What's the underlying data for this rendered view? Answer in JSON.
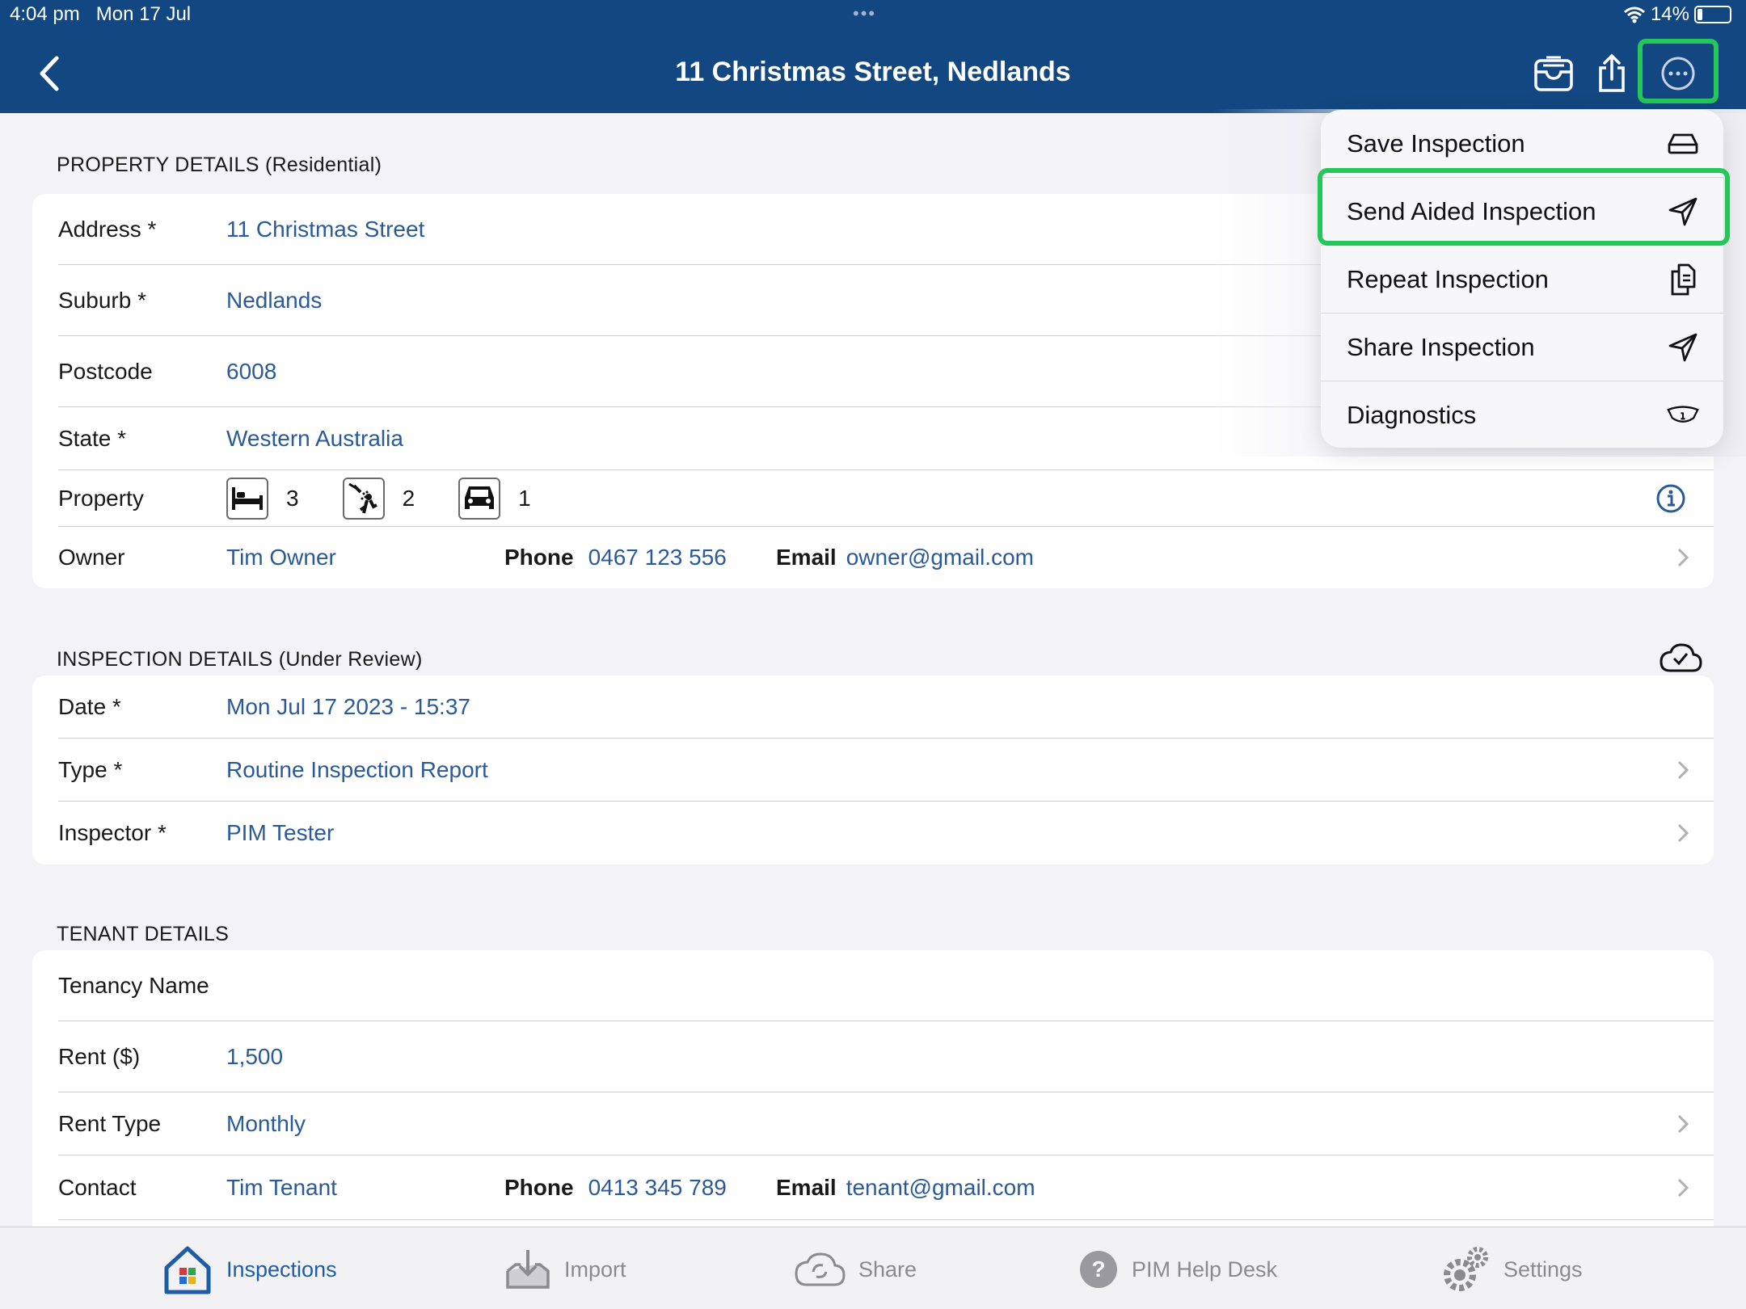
{
  "status": {
    "time": "4:04 pm",
    "date": "Mon 17 Jul",
    "battery": "14%"
  },
  "header": {
    "title": "11 Christmas Street, Nedlands"
  },
  "property": {
    "section_title": "PROPERTY DETAILS (Residential)",
    "address_label": "Address *",
    "address": "11 Christmas Street",
    "suburb_label": "Suburb *",
    "suburb": "Nedlands",
    "postcode_label": "Postcode",
    "postcode": "6008",
    "state_label": "State *",
    "state": "Western Australia",
    "property_label": "Property",
    "bedrooms": "3",
    "bathrooms": "2",
    "carspaces": "1",
    "owner_label": "Owner",
    "owner": "Tim Owner",
    "phone_label": "Phone",
    "owner_phone": "0467 123 556",
    "email_label": "Email",
    "owner_email": "owner@gmail.com"
  },
  "inspection": {
    "section_title": "INSPECTION DETAILS (Under Review)",
    "date_label": "Date *",
    "date": "Mon Jul 17 2023 - 15:37",
    "type_label": "Type *",
    "type": "Routine Inspection Report",
    "inspector_label": "Inspector *",
    "inspector": "PIM Tester"
  },
  "tenant": {
    "section_title": "TENANT DETAILS",
    "tenancy_label": "Tenancy Name",
    "rent_label": "Rent ($)",
    "rent": "1,500",
    "rent_type_label": "Rent Type",
    "rent_type": "Monthly",
    "contact_label": "Contact",
    "contact": "Tim Tenant",
    "phone_label": "Phone",
    "phone": "0413 345 789",
    "email_label": "Email",
    "email": "tenant@gmail.com"
  },
  "menu": {
    "items": [
      {
        "label": "Save Inspection",
        "icon": "drive-icon"
      },
      {
        "label": "Send Aided Inspection",
        "icon": "paper-plane-icon"
      },
      {
        "label": "Repeat Inspection",
        "icon": "copy-icon"
      },
      {
        "label": "Share Inspection",
        "icon": "paper-plane-icon"
      },
      {
        "label": "Diagnostics",
        "icon": "info-tag-icon"
      }
    ]
  },
  "tabbar": {
    "inspections": "Inspections",
    "import": "Import",
    "share": "Share",
    "helpdesk": "PIM Help Desk",
    "settings": "Settings"
  },
  "colors": {
    "header": "#124781",
    "accent": "#2a5a99",
    "highlight": "#24c75a"
  }
}
